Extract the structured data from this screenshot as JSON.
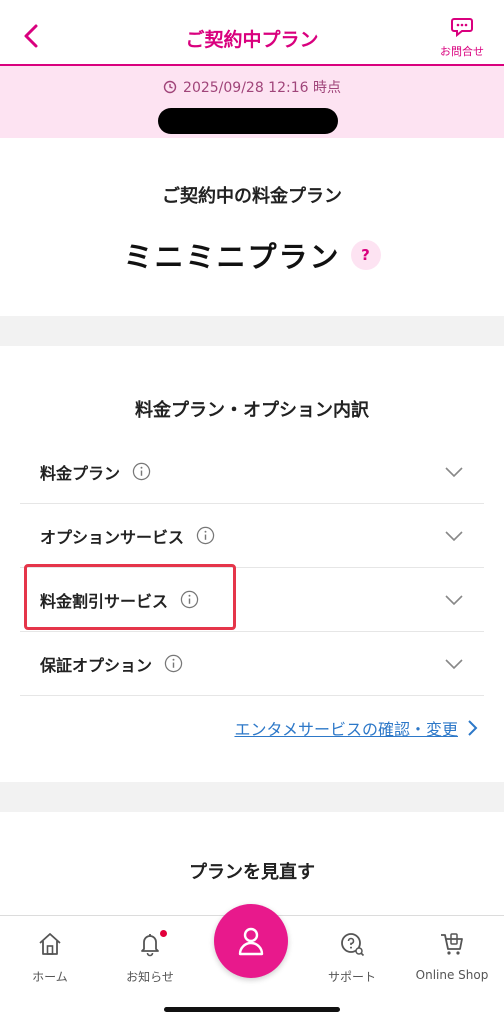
{
  "header": {
    "title": "ご契約中プラン",
    "contact_label": "お問合せ",
    "accent_color": "#d9007e"
  },
  "timestamp": {
    "text": "2025/09/28 12:16 時点"
  },
  "plan": {
    "heading": "ご契約中の料金プラン",
    "name": "ミニミニプラン",
    "help_mark": "?"
  },
  "breakdown": {
    "heading": "料金プラン・オプション内訳",
    "items": [
      {
        "label": "料金プラン"
      },
      {
        "label": "オプションサービス"
      },
      {
        "label": "料金割引サービス"
      },
      {
        "label": "保証オプション"
      }
    ],
    "enta_link": "エンタメサービスの確認・変更"
  },
  "review": {
    "heading": "プランを見直す"
  },
  "bottom_nav": {
    "items": [
      {
        "label": "ホーム",
        "icon": "home-icon"
      },
      {
        "label": "お知らせ",
        "icon": "bell-icon"
      },
      {
        "label": "",
        "icon": "person-icon"
      },
      {
        "label": "サポート",
        "icon": "support-icon"
      },
      {
        "label": "Online Shop",
        "icon": "cart-icon"
      }
    ]
  }
}
